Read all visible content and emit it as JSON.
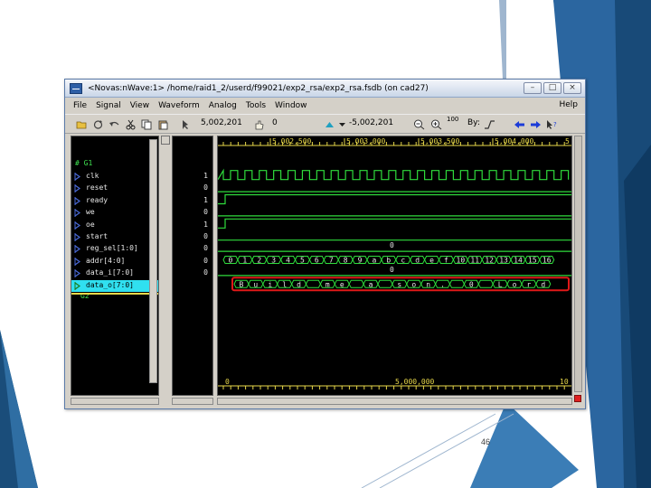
{
  "slide": {
    "page_number": "46"
  },
  "window": {
    "title": "<Novas:nWave:1> /home/raid1_2/userd/f99021/exp2_rsa/exp2_rsa.fsdb (on cad27)",
    "controls": {
      "minimize": "–",
      "maximize": "□",
      "close": "×"
    }
  },
  "menu": {
    "items": [
      "File",
      "Signal",
      "View",
      "Waveform",
      "Analog",
      "Tools",
      "Window"
    ],
    "help": "Help"
  },
  "toolbar": {
    "cursor_time": "5,002,201",
    "marker_time": "0",
    "delta_time": "-5,002,201",
    "zoom_factor": "100",
    "by_label": "By:"
  },
  "time_ruler": {
    "ticks": [
      "5,002,500",
      "5,003,000",
      "5,003,500",
      "5,004,000"
    ],
    "edge_label": "5"
  },
  "bottom_ruler": {
    "start": "0",
    "mid": "5,000,000",
    "end": "10"
  },
  "groups": [
    {
      "label": "# G1"
    },
    {
      "label": "G2"
    }
  ],
  "signals": [
    {
      "name": "clk",
      "value": "1",
      "kind": "clock"
    },
    {
      "name": "reset",
      "value": "0",
      "kind": "low"
    },
    {
      "name": "ready",
      "value": "1",
      "kind": "high"
    },
    {
      "name": "we",
      "value": "0",
      "kind": "low"
    },
    {
      "name": "oe",
      "value": "1",
      "kind": "high"
    },
    {
      "name": "start",
      "value": "0",
      "kind": "low"
    },
    {
      "name": "reg_sel[1:0]",
      "value": "0",
      "kind": "bus_const",
      "bus_label": "0"
    },
    {
      "name": "addr[4:0]",
      "value": "0",
      "kind": "bus",
      "segments": [
        "0",
        "1",
        "2",
        "3",
        "4",
        "5",
        "6",
        "7",
        "8",
        "9",
        "a",
        "b",
        "c",
        "d",
        "e",
        "f",
        "10",
        "11",
        "12",
        "13",
        "14",
        "15",
        "16"
      ]
    },
    {
      "name": "data_i[7:0]",
      "value": "0",
      "kind": "bus_const",
      "bus_label": "0"
    },
    {
      "name": "data_o[7:0]",
      "value": "",
      "kind": "bus",
      "selected": true,
      "segments": [
        "B",
        "u",
        "i",
        "l",
        "d",
        "",
        "m",
        "e",
        "",
        "a",
        "",
        "s",
        "o",
        "n",
        ".",
        "",
        "0",
        "",
        "L",
        "o",
        "r",
        "d"
      ]
    }
  ],
  "colors": {
    "wave_green": "#2fdc3c",
    "bus_label": "#e8e8e8",
    "highlight_box": "#e01818",
    "selected_row": "#30e0f0",
    "ruler_yellow": "#e8d84a",
    "panel_bg": "#000000",
    "window_chrome": "#d4d0c8"
  }
}
